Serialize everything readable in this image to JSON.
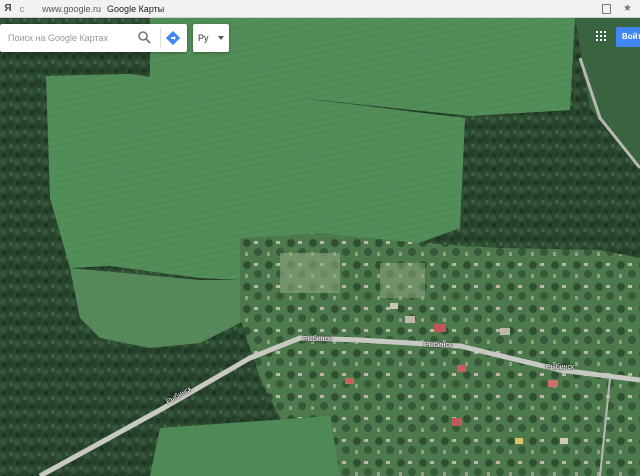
{
  "browser": {
    "logo": "Я",
    "url": "www.google.ru",
    "title": "Google Карты"
  },
  "search": {
    "placeholder": "Поиск на Google Картах"
  },
  "language": {
    "value": "Ру"
  },
  "signin": {
    "label": "Войти"
  },
  "map": {
    "road_labels": [
      "Рыбинск",
      "Рыбинск",
      "Рыбинск",
      "Рыбинск"
    ]
  },
  "icons": {
    "search": "search-icon",
    "directions": "directions-icon",
    "apps": "apps-icon",
    "reload": "reload-icon",
    "star": "star-icon",
    "tab": "tab-icon"
  },
  "colors": {
    "accent": "#4285f4",
    "field": "#4f8a55",
    "forest": "#2a4a2c",
    "road": "#c8c8c4"
  }
}
